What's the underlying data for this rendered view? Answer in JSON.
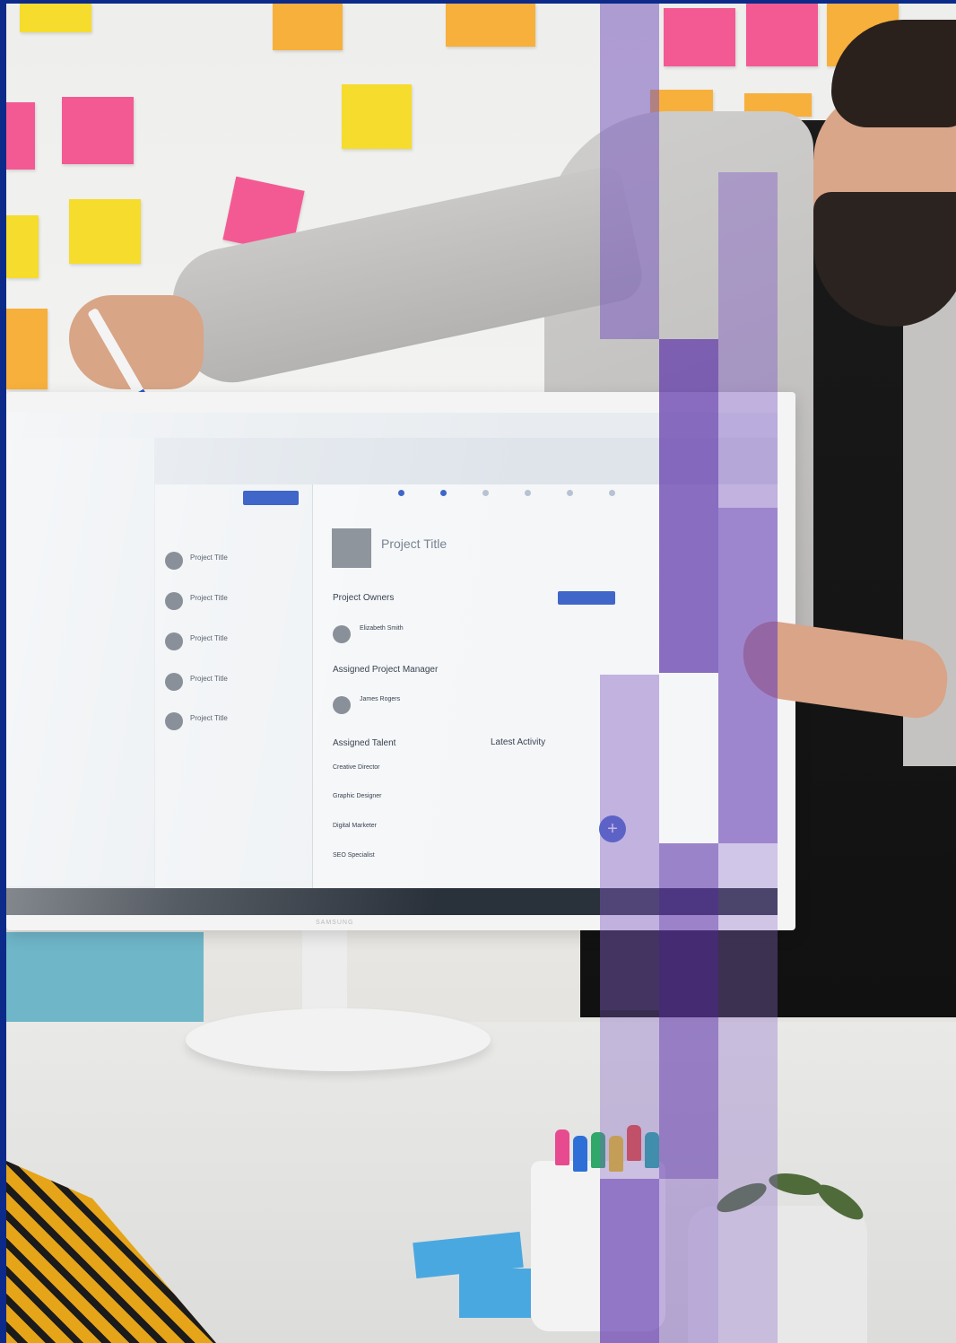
{
  "screen": {
    "project_title": "Project Title",
    "project_owners": "Project Owners",
    "owner_name": "Elizabeth Smith",
    "assigned_pm": "Assigned Project Manager",
    "pm_name": "James Rogers",
    "assigned_talent": "Assigned Talent",
    "latest_activity": "Latest Activity",
    "talent": [
      "Creative Director",
      "Graphic Designer",
      "Digital Marketer",
      "SEO Specialist"
    ],
    "list_items": [
      "Project Title",
      "Project Title",
      "Project Title",
      "Project Title",
      "Project Title"
    ],
    "fab_icon": "+",
    "brand_label": "SAMSUNG"
  },
  "colors": {
    "background_frame": "#0b2a8a",
    "overlay_purple": "#6a3fa8",
    "accent_blue": "#3f66c8"
  }
}
